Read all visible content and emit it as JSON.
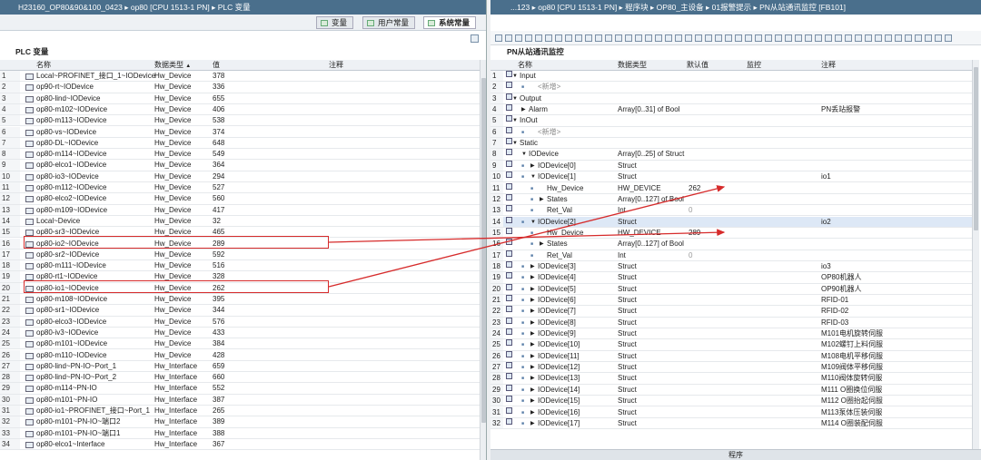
{
  "left": {
    "title": "H23160_OP80&90&100_0423 ▸ op80 [CPU 1513-1 PN] ▸ PLC 变量",
    "tabs": [
      "变量",
      "用户常量",
      "系统常量"
    ],
    "section_title": "PLC 变量",
    "headers": {
      "name": "名称",
      "type": "数据类型",
      "value": "值",
      "comment": "注释"
    },
    "rows": [
      [
        "1",
        "Local~PROFINET_接口_1~IODevice",
        "Hw_Device",
        "378"
      ],
      [
        "2",
        "op90-rt~IODevice",
        "Hw_Device",
        "336"
      ],
      [
        "3",
        "op80-lind~IODevice",
        "Hw_Device",
        "655"
      ],
      [
        "4",
        "op80-m102~IODevice",
        "Hw_Device",
        "406"
      ],
      [
        "5",
        "op80-m113~IODevice",
        "Hw_Device",
        "538"
      ],
      [
        "6",
        "op80-vs~IODevice",
        "Hw_Device",
        "374"
      ],
      [
        "7",
        "op80-DL~IODevice",
        "Hw_Device",
        "648"
      ],
      [
        "8",
        "op80-m114~IODevice",
        "Hw_Device",
        "549"
      ],
      [
        "9",
        "op80-elco1~IODevice",
        "Hw_Device",
        "364"
      ],
      [
        "10",
        "op80-io3~IODevice",
        "Hw_Device",
        "294"
      ],
      [
        "11",
        "op80-m112~IODevice",
        "Hw_Device",
        "527"
      ],
      [
        "12",
        "op80-elco2~IODevice",
        "Hw_Device",
        "560"
      ],
      [
        "13",
        "op80-m109~IODevice",
        "Hw_Device",
        "417"
      ],
      [
        "14",
        "Local~Device",
        "Hw_Device",
        "32"
      ],
      [
        "15",
        "op80-sr3~IODevice",
        "Hw_Device",
        "465"
      ],
      [
        "16",
        "op80-io2~IODevice",
        "Hw_Device",
        "289"
      ],
      [
        "17",
        "op80-sr2~IODevice",
        "Hw_Device",
        "592"
      ],
      [
        "18",
        "op80-m111~IODevice",
        "Hw_Device",
        "516"
      ],
      [
        "19",
        "op80-rt1~IODevice",
        "Hw_Device",
        "328"
      ],
      [
        "20",
        "op80-io1~IODevice",
        "Hw_Device",
        "262"
      ],
      [
        "21",
        "op80-m108~IODevice",
        "Hw_Device",
        "395"
      ],
      [
        "22",
        "op80-sr1~IODevice",
        "Hw_Device",
        "344"
      ],
      [
        "23",
        "op80-elco3~IODevice",
        "Hw_Device",
        "576"
      ],
      [
        "24",
        "op80-iv3~IODevice",
        "Hw_Device",
        "433"
      ],
      [
        "25",
        "op80-m101~IODevice",
        "Hw_Device",
        "384"
      ],
      [
        "26",
        "op80-m110~IODevice",
        "Hw_Device",
        "428"
      ],
      [
        "27",
        "op80-lind~PN-IO~Port_1",
        "Hw_Interface",
        "659"
      ],
      [
        "28",
        "op80-lind~PN-IO~Port_2",
        "Hw_Interface",
        "660"
      ],
      [
        "29",
        "op80-m114~PN-IO",
        "Hw_Interface",
        "552"
      ],
      [
        "30",
        "op80-m101~PN-IO",
        "Hw_Interface",
        "387"
      ],
      [
        "31",
        "op80-io1~PROFINET_接口~Port_1",
        "Hw_Interface",
        "265"
      ],
      [
        "32",
        "op80-m101~PN-IO~端口2",
        "Hw_Interface",
        "389"
      ],
      [
        "33",
        "op80-m101~PN-IO~端口1",
        "Hw_Interface",
        "388"
      ],
      [
        "34",
        "op80-elco1~Interface",
        "Hw_Interface",
        "367"
      ]
    ]
  },
  "right": {
    "title": "...123 ▸ op80 [CPU 1513-1 PN] ▸ 程序块 ▸ OP80_主设备 ▸ 01报警提示 ▸ PN从站通讯监控 [FB101]",
    "section_title": "PN从站通讯监控",
    "headers": {
      "name": "名称",
      "type": "数据类型",
      "default": "默认值",
      "monitor": "监控",
      "comment": "注释"
    },
    "rows": [
      {
        "n": "1",
        "name": "Input",
        "ind": 0,
        "exp": "down",
        "type": "",
        "def": "",
        "cmt": ""
      },
      {
        "n": "2",
        "name": "<新增>",
        "ind": 2,
        "exp": "",
        "type": "",
        "def": "",
        "cmt": "",
        "grey": true
      },
      {
        "n": "3",
        "name": "Output",
        "ind": 0,
        "exp": "down",
        "type": "",
        "def": "",
        "cmt": ""
      },
      {
        "n": "4",
        "name": "Alarm",
        "ind": 1,
        "exp": "right",
        "type": "Array[0..31] of Bool",
        "def": "",
        "cmt": "PN丢站报警"
      },
      {
        "n": "5",
        "name": "InOut",
        "ind": 0,
        "exp": "down",
        "type": "",
        "def": "",
        "cmt": ""
      },
      {
        "n": "6",
        "name": "<新增>",
        "ind": 2,
        "exp": "",
        "type": "",
        "def": "",
        "cmt": "",
        "grey": true
      },
      {
        "n": "7",
        "name": "Static",
        "ind": 0,
        "exp": "down",
        "type": "",
        "def": "",
        "cmt": ""
      },
      {
        "n": "8",
        "name": "IODevice",
        "ind": 1,
        "exp": "down",
        "type": "Array[0..25] of Struct",
        "def": "",
        "cmt": ""
      },
      {
        "n": "9",
        "name": "IODevice[0]",
        "ind": 2,
        "exp": "right",
        "type": "Struct",
        "def": "",
        "cmt": ""
      },
      {
        "n": "10",
        "name": "IODevice[1]",
        "ind": 2,
        "exp": "down",
        "type": "Struct",
        "def": "",
        "cmt": "io1"
      },
      {
        "n": "11",
        "name": "Hw_Device",
        "ind": 3,
        "exp": "",
        "type": "HW_DEVICE",
        "def": "262",
        "cmt": ""
      },
      {
        "n": "12",
        "name": "States",
        "ind": 3,
        "exp": "right",
        "type": "Array[0..127] of Bool",
        "def": "",
        "cmt": ""
      },
      {
        "n": "13",
        "name": "Ret_Val",
        "ind": 3,
        "exp": "",
        "type": "Int",
        "def": "0",
        "cmt": "",
        "greydef": true
      },
      {
        "n": "14",
        "name": "IODevice[2]",
        "ind": 2,
        "exp": "down",
        "type": "Struct",
        "def": "",
        "cmt": "io2",
        "sel": true
      },
      {
        "n": "15",
        "name": "Hw_Device",
        "ind": 3,
        "exp": "",
        "type": "HW_DEVICE",
        "def": "289",
        "cmt": ""
      },
      {
        "n": "16",
        "name": "States",
        "ind": 3,
        "exp": "right",
        "type": "Array[0..127] of Bool",
        "def": "",
        "cmt": ""
      },
      {
        "n": "17",
        "name": "Ret_Val",
        "ind": 3,
        "exp": "",
        "type": "Int",
        "def": "0",
        "cmt": "",
        "greydef": true
      },
      {
        "n": "18",
        "name": "IODevice[3]",
        "ind": 2,
        "exp": "right",
        "type": "Struct",
        "def": "",
        "cmt": "io3"
      },
      {
        "n": "19",
        "name": "IODevice[4]",
        "ind": 2,
        "exp": "right",
        "type": "Struct",
        "def": "",
        "cmt": "OP80机器人"
      },
      {
        "n": "20",
        "name": "IODevice[5]",
        "ind": 2,
        "exp": "right",
        "type": "Struct",
        "def": "",
        "cmt": "OP90机器人"
      },
      {
        "n": "21",
        "name": "IODevice[6]",
        "ind": 2,
        "exp": "right",
        "type": "Struct",
        "def": "",
        "cmt": "RFID-01"
      },
      {
        "n": "22",
        "name": "IODevice[7]",
        "ind": 2,
        "exp": "right",
        "type": "Struct",
        "def": "",
        "cmt": "RFID-02"
      },
      {
        "n": "23",
        "name": "IODevice[8]",
        "ind": 2,
        "exp": "right",
        "type": "Struct",
        "def": "",
        "cmt": "RFID-03"
      },
      {
        "n": "24",
        "name": "IODevice[9]",
        "ind": 2,
        "exp": "right",
        "type": "Struct",
        "def": "",
        "cmt": "M101电机旋转伺服"
      },
      {
        "n": "25",
        "name": "IODevice[10]",
        "ind": 2,
        "exp": "right",
        "type": "Struct",
        "def": "",
        "cmt": "M102螺钉上料伺服"
      },
      {
        "n": "26",
        "name": "IODevice[11]",
        "ind": 2,
        "exp": "right",
        "type": "Struct",
        "def": "",
        "cmt": "M108电机平移伺服"
      },
      {
        "n": "27",
        "name": "IODevice[12]",
        "ind": 2,
        "exp": "right",
        "type": "Struct",
        "def": "",
        "cmt": "M109阀体平移伺服"
      },
      {
        "n": "28",
        "name": "IODevice[13]",
        "ind": 2,
        "exp": "right",
        "type": "Struct",
        "def": "",
        "cmt": "M110阀体旋转伺服"
      },
      {
        "n": "29",
        "name": "IODevice[14]",
        "ind": 2,
        "exp": "right",
        "type": "Struct",
        "def": "",
        "cmt": "M111 O圈换位伺服"
      },
      {
        "n": "30",
        "name": "IODevice[15]",
        "ind": 2,
        "exp": "right",
        "type": "Struct",
        "def": "",
        "cmt": "M112 O圈抬起伺服"
      },
      {
        "n": "31",
        "name": "IODevice[16]",
        "ind": 2,
        "exp": "right",
        "type": "Struct",
        "def": "",
        "cmt": "M113泵体压装伺服"
      },
      {
        "n": "32",
        "name": "IODevice[17]",
        "ind": 2,
        "exp": "right",
        "type": "Struct",
        "def": "",
        "cmt": "M114 O圈装配伺服"
      }
    ],
    "footer": "程序"
  },
  "colors": {
    "titlebar": "#4a6f8c",
    "highlight": "#d62b2b",
    "selection": "#dde8f6"
  }
}
